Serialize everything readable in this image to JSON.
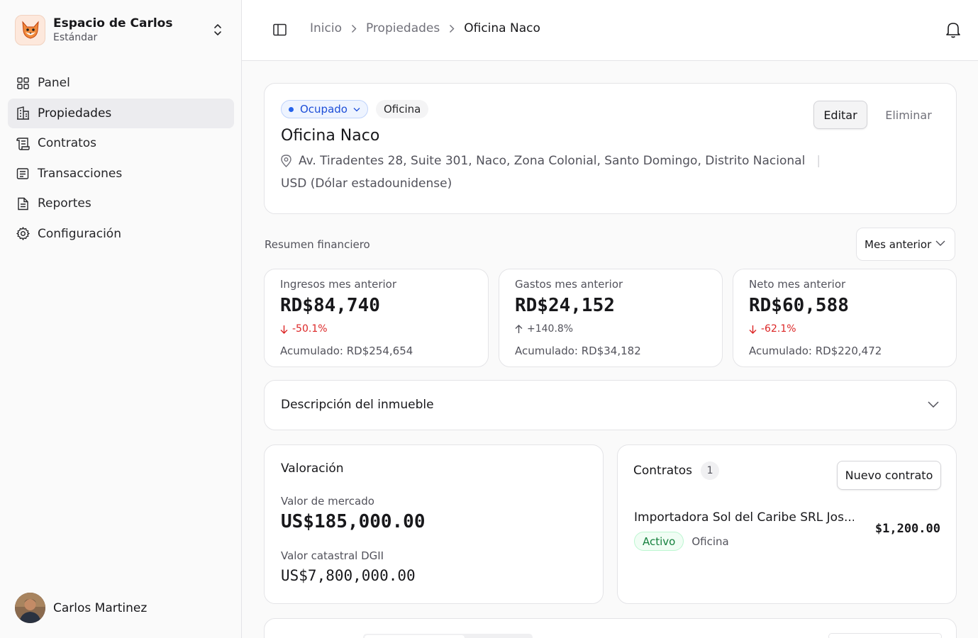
{
  "workspace": {
    "name": "Espacio de Carlos",
    "plan": "Estándar"
  },
  "sidebar": {
    "items": [
      {
        "label": "Panel",
        "icon": "grid-icon",
        "active": false
      },
      {
        "label": "Propiedades",
        "icon": "building-icon",
        "active": true
      },
      {
        "label": "Contratos",
        "icon": "scroll-icon",
        "active": false
      },
      {
        "label": "Transacciones",
        "icon": "receipt-icon",
        "active": false
      },
      {
        "label": "Reportes",
        "icon": "file-text-icon",
        "active": false
      },
      {
        "label": "Configuración",
        "icon": "gear-icon",
        "active": false
      }
    ]
  },
  "user": {
    "name": "Carlos Martinez"
  },
  "breadcrumb": {
    "items": [
      "Inicio",
      "Propiedades"
    ],
    "current": "Oficina Naco"
  },
  "property": {
    "status": "Ocupado",
    "type": "Oficina",
    "title": "Oficina Naco",
    "address": "Av. Tiradentes 28, Suite 301, Naco, Zona Colonial, Santo Domingo, Distrito Nacional",
    "separator": "|",
    "currency": "USD (Dólar estadounidense)",
    "edit_label": "Editar",
    "delete_label": "Eliminar"
  },
  "financial": {
    "title": "Resumen financiero",
    "period": "Mes anterior",
    "stats": [
      {
        "label": "Ingresos mes anterior",
        "value": "RD$84,740",
        "change": "-50.1%",
        "direction": "down",
        "accumulated": "Acumulado: RD$254,654"
      },
      {
        "label": "Gastos mes anterior",
        "value": "RD$24,152",
        "change": "+140.8%",
        "direction": "up",
        "accumulated": "Acumulado: RD$34,182"
      },
      {
        "label": "Neto mes anterior",
        "value": "RD$60,588",
        "change": "-62.1%",
        "direction": "down",
        "accumulated": "Acumulado: RD$220,472"
      }
    ]
  },
  "description": {
    "title": "Descripción del inmueble"
  },
  "valuation": {
    "title": "Valoración",
    "market_label": "Valor de mercado",
    "market_value": "US$185,000.00",
    "cadastral_label": "Valor catastral DGII",
    "cadastral_value": "US$7,800,000.00"
  },
  "contracts": {
    "title": "Contratos",
    "count": "1",
    "new_label": "Nuevo contrato",
    "items": [
      {
        "tenant": "Importadora Sol del Caribe SRL Jos...",
        "status": "Activo",
        "type": "Oficina",
        "amount": "$1,200.00"
      }
    ]
  },
  "colors": {
    "accent_blue": "#2563eb",
    "negative": "#dc2626",
    "active_green": "#15803d"
  }
}
